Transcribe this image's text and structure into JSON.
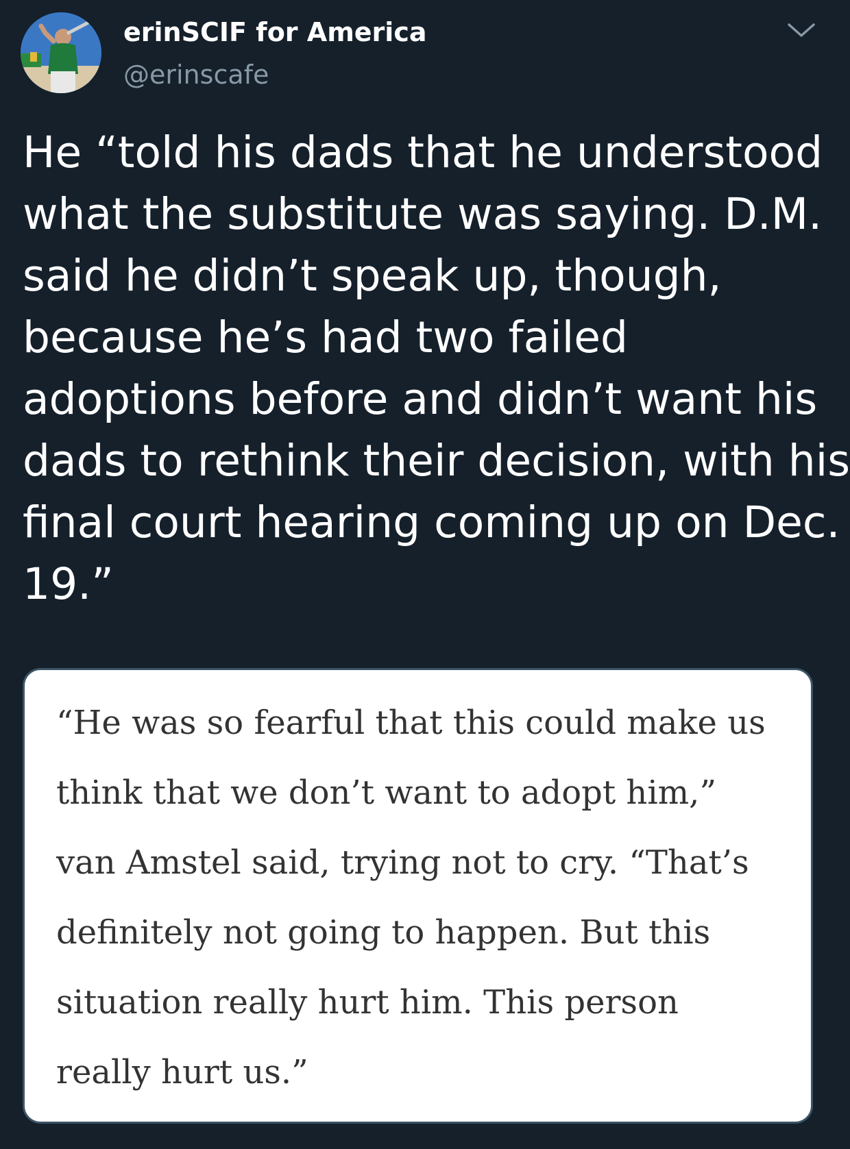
{
  "tweet": {
    "author": {
      "display_name": "erinSCIF for America",
      "handle": "@erinscafe",
      "avatar_icon": "avatar-photo-batter"
    },
    "menu_icon": "chevron-down-icon",
    "text_lines": [
      "He “told his dads that he understood",
      "what the substitute was saying. D.M.",
      "said he didn’t speak up, though,",
      "because he’s had two failed",
      "adoptions before and didn’t want his",
      "dads to rethink their decision, with his",
      "final court hearing coming up on Dec.",
      "19.”"
    ],
    "quote_image": {
      "lines": [
        "“He was so fearful that this could make us",
        "think that we don’t want to adopt him,”",
        "van Amstel said, trying not to cry. “That’s",
        "definitely not going to happen. But this",
        "situation really hurt him. This person",
        "really hurt us.”"
      ]
    }
  },
  "colors": {
    "background": "#15202b",
    "primary_text": "#ffffff",
    "secondary_text": "#8899a6",
    "card_background": "#ffffff",
    "card_text": "#333333"
  }
}
